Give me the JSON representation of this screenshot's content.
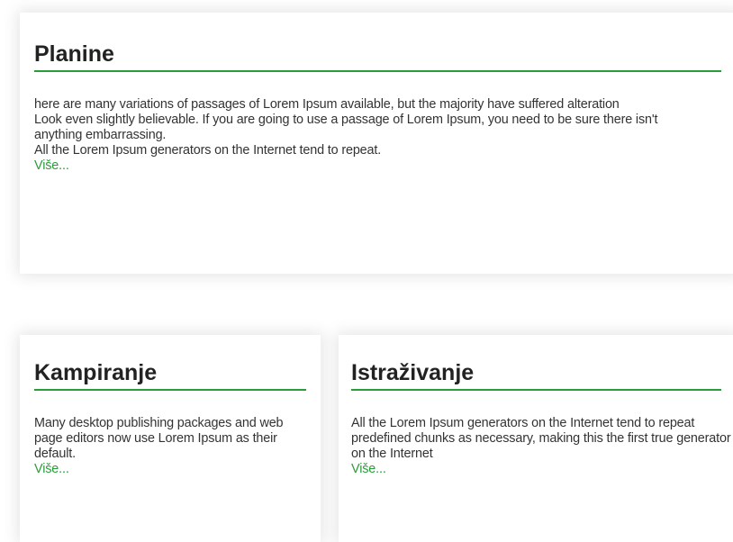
{
  "more_label": "Više...",
  "cards": [
    {
      "title": "Planine",
      "paragraphs": [
        "here are many variations of passages of Lorem Ipsum available, but the majority have suffered alteration",
        "Look even slightly believable. If you are going to use a passage of Lorem Ipsum, you need to be sure there isn't anything embarrassing.",
        "All the Lorem Ipsum generators on the Internet tend to repeat."
      ],
      "more_label": "Više..."
    },
    {
      "title": "Kampiranje",
      "paragraphs": [
        "Many desktop publishing packages and web page editors now use Lorem Ipsum as their default."
      ],
      "more_label": "Više..."
    },
    {
      "title": "Istraživanje",
      "paragraphs": [
        "All the Lorem Ipsum generators on the Internet tend to repeat predefined chunks as necessary, making this the first true generator on the Internet"
      ],
      "more_label": "Više..."
    }
  ],
  "colors": {
    "accent": "#2a9d3b",
    "title_text": "#222222",
    "body_text": "#333333"
  }
}
